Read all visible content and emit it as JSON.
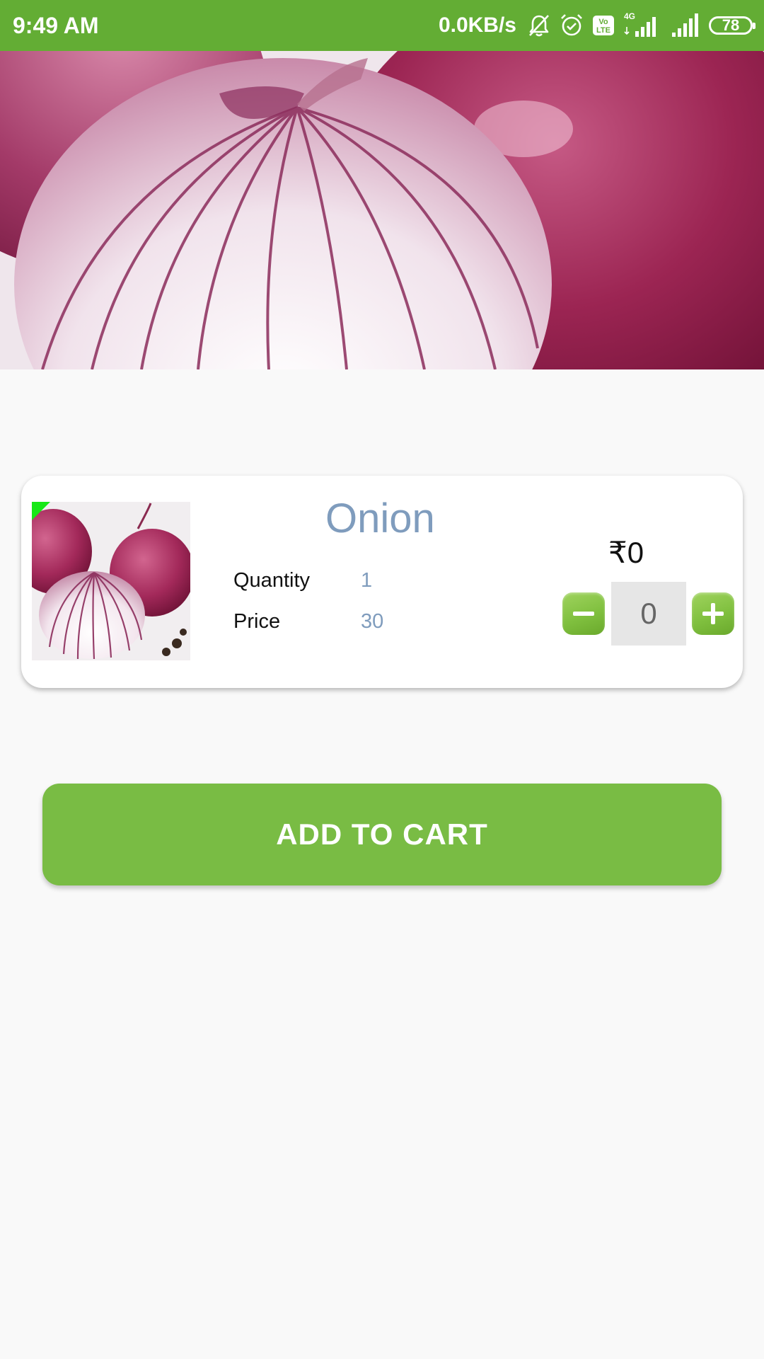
{
  "status_bar": {
    "time": "9:49 AM",
    "network_speed": "0.0KB/s",
    "network_type": "4G",
    "volte_label": "Vo LTE",
    "battery_level": "78",
    "icons": [
      "notifications-off-icon",
      "alarm-icon",
      "volte-icon",
      "signal-4g-icon",
      "signal-icon",
      "battery-icon"
    ],
    "background_color": "#63ad34"
  },
  "hero": {
    "image": "onion-banner-image"
  },
  "product": {
    "name": "Onion",
    "quantity_label": "Quantity",
    "quantity_value": "1",
    "price_label": "Price",
    "price_value": "30",
    "total_price": "₹0",
    "cart_count": "0",
    "thumbnail": "onion-thumbnail-image"
  },
  "actions": {
    "add_to_cart_label": "ADD TO CART",
    "decrement_icon": "minus-icon",
    "increment_icon": "plus-icon"
  },
  "colors": {
    "accent_green": "#79bc44",
    "product_name_color": "#7f9cbd",
    "page_background": "#f9f9f9"
  }
}
